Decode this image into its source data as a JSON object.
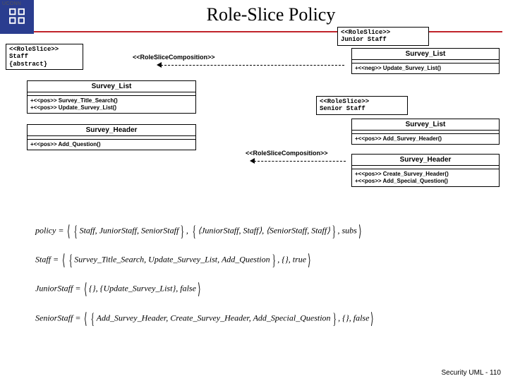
{
  "header": {
    "title": "Role-Slice Policy",
    "org_small": "UCONN"
  },
  "footer": {
    "text": "Security UML - 110"
  },
  "boxes": {
    "staff": {
      "stereo": "<<RoleSlice>>",
      "name": "Staff",
      "mod": "{abstract}"
    },
    "junior": {
      "stereo": "<<RoleSlice>>",
      "name": "Junior Staff"
    },
    "senior": {
      "stereo": "<<RoleSlice>>",
      "name": "Senior Staff"
    },
    "survey_list1": {
      "name": "Survey_List",
      "op1": "+<<pos>> Survey_Title_Search()",
      "op2": "+<<pos>> Update_Survey_List()"
    },
    "survey_header1": {
      "name": "Survey_Header",
      "op1": "+<<pos>> Add_Question()"
    },
    "survey_list2": {
      "name": "Survey_List",
      "op1": "+<<neg>> Update_Survey_List()"
    },
    "survey_list3": {
      "name": "Survey_List",
      "op1": "+<<pos>> Add_Survey_Header()"
    },
    "survey_header2": {
      "name": "Survey_Header",
      "op1": "+<<pos>> Create_Survey_Header()",
      "op2": "+<<pos>> Add_Special_Question()"
    }
  },
  "relations": {
    "comp1": "<<RoleSliceComposition>>",
    "comp2": "<<RoleSliceComposition>>"
  },
  "equations": {
    "policy": "policy = ⟨{Staff, JuniorStaff, SeniorStaff}, {⟨JuniorStaff, Staff⟩, ⟨SeniorStaff, Staff⟩}, subs⟩",
    "staff": "Staff = ⟨{Survey_Title_Search, Update_Survey_List, Add_Question}, {}, true⟩",
    "junior": "JuniorStaff = ⟨{}, {Update_Survey_List}, false⟩",
    "senior": "SeniorStaff = ⟨{Add_Survey_Header, Create_Survey_Header, Add_Special_Question}, {}, false⟩"
  },
  "chart_data": {
    "type": "diagram",
    "nodes": [
      {
        "id": "Staff",
        "stereotype": "RoleSlice",
        "abstract": true,
        "classes": [
          {
            "name": "Survey_List",
            "ops": [
              {
                "perm": "pos",
                "name": "Survey_Title_Search"
              },
              {
                "perm": "pos",
                "name": "Update_Survey_List"
              }
            ]
          },
          {
            "name": "Survey_Header",
            "ops": [
              {
                "perm": "pos",
                "name": "Add_Question"
              }
            ]
          }
        ]
      },
      {
        "id": "Junior Staff",
        "stereotype": "RoleSlice",
        "classes": [
          {
            "name": "Survey_List",
            "ops": [
              {
                "perm": "neg",
                "name": "Update_Survey_List"
              }
            ]
          }
        ]
      },
      {
        "id": "Senior Staff",
        "stereotype": "RoleSlice",
        "classes": [
          {
            "name": "Survey_List",
            "ops": [
              {
                "perm": "pos",
                "name": "Add_Survey_Header"
              }
            ]
          },
          {
            "name": "Survey_Header",
            "ops": [
              {
                "perm": "pos",
                "name": "Create_Survey_Header"
              },
              {
                "perm": "pos",
                "name": "Add_Special_Question"
              }
            ]
          }
        ]
      }
    ],
    "edges": [
      {
        "from": "Junior Staff",
        "to": "Staff",
        "label": "RoleSliceComposition"
      },
      {
        "from": "Senior Staff",
        "to": "Staff",
        "label": "RoleSliceComposition"
      }
    ]
  }
}
